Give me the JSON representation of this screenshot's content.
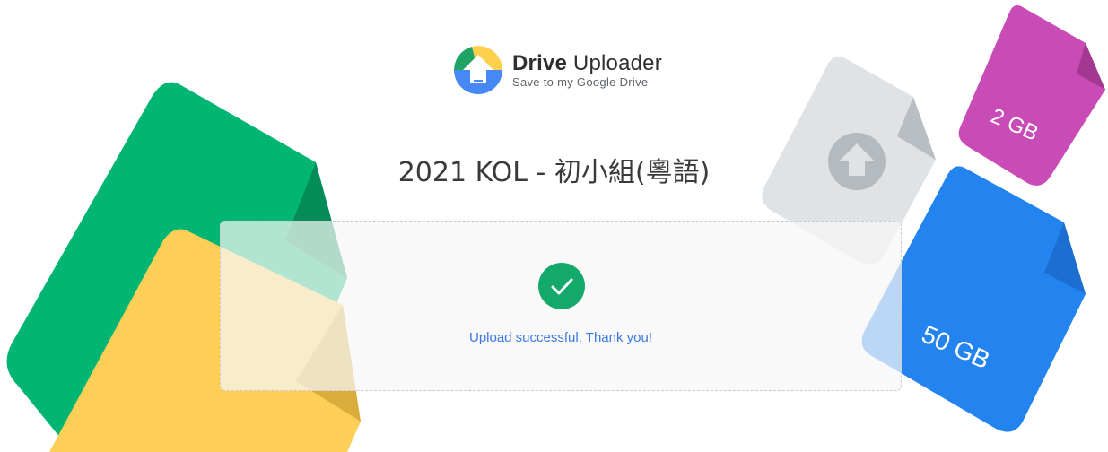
{
  "brand": {
    "name_bold": "Drive",
    "name_regular": " Uploader",
    "tagline": "Save to my Google Drive"
  },
  "form": {
    "title": "2021 KOL - 初小組(粵語)"
  },
  "upload": {
    "status_icon": "check-circle-icon",
    "status_message": "Upload successful. Thank you!"
  },
  "decorations": {
    "files": [
      {
        "label": "2 GB",
        "color": "#c94bb5"
      },
      {
        "label": "50 GB",
        "color": "#2384f0"
      },
      {
        "label": "",
        "color": "#e0e3e6",
        "icon": "drive-logo-icon"
      },
      {
        "label": "",
        "color": "#02b572"
      },
      {
        "label": "",
        "color": "#fecf57"
      }
    ]
  },
  "colors": {
    "success": "#12a96a",
    "link_blue": "#3b78e7",
    "google_green": "#1fa463",
    "google_yellow": "#ffd04b",
    "google_blue": "#4688f4"
  }
}
